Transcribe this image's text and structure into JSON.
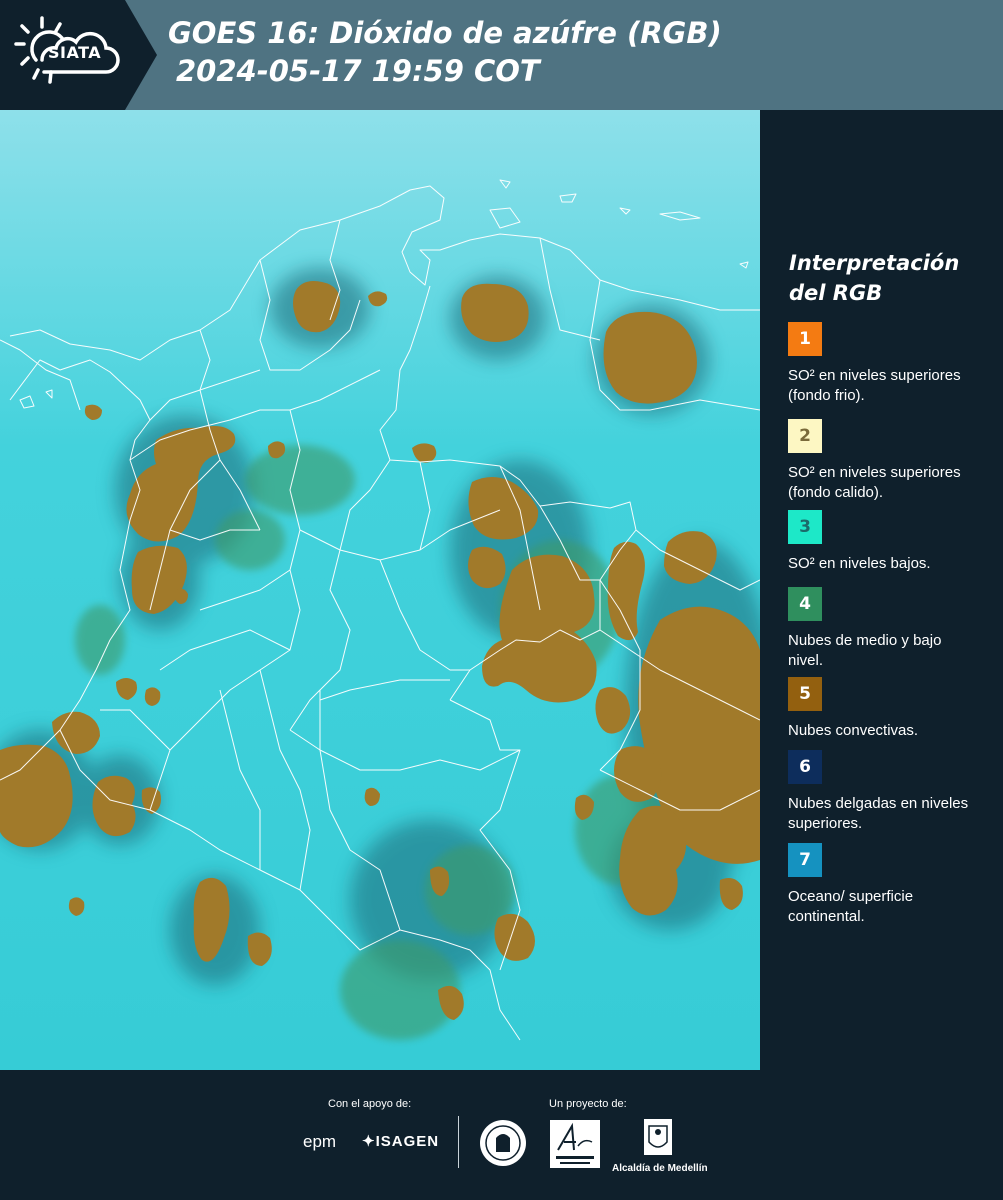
{
  "header": {
    "logo_text": "SIATA",
    "title_line1": "GOES 16: Dióxido de azúfre (RGB)",
    "title_line2": "2024-05-17 19:59 COT"
  },
  "legend": {
    "title_line1": "Interpretación",
    "title_line2": "del RGB",
    "items": [
      {
        "number": "1",
        "color": "#f47b12",
        "text": "SO² en niveles superiores (fondo frio)."
      },
      {
        "number": "2",
        "color": "#fdf7c3",
        "text": "SO² en niveles superiores (fondo calido)."
      },
      {
        "number": "3",
        "color": "#1de8c8",
        "text": "SO² en niveles bajos."
      },
      {
        "number": "4",
        "color": "#2f8f5e",
        "text": "Nubes de medio y bajo nivel."
      },
      {
        "number": "5",
        "color": "#93600f",
        "text": "Nubes convectivas."
      },
      {
        "number": "6",
        "color": "#0d2d5c",
        "text": "Nubes delgadas en niveles superiores."
      },
      {
        "number": "7",
        "color": "#1592c0",
        "text": "Oceano/ superficie continental."
      }
    ]
  },
  "map": {
    "background_color": "#3ecfd6",
    "cloud_color": "#a17a2a",
    "border_color": "#ffffff"
  },
  "footer": {
    "support_label": "Con el apoyo de:",
    "project_label": "Un proyecto de:",
    "sponsor_epm": "epm",
    "sponsor_isagen": "ISAGEN",
    "alcaldia": "Alcaldía de Medellín"
  }
}
